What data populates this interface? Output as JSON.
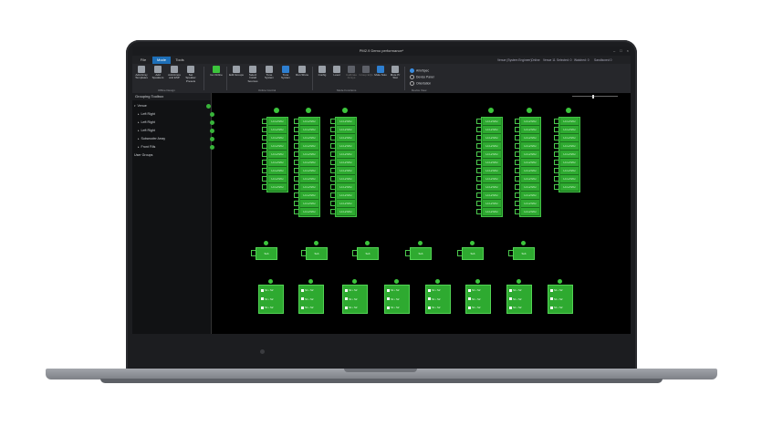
{
  "app": {
    "title": "PM2.9 Demo performance*",
    "window_controls": [
      "–",
      "□",
      "×"
    ],
    "tabs": [
      "File",
      "Mode",
      "Tools"
    ],
    "active_tab": "Mode",
    "status_items": [
      "Venue (System Engineer)",
      "Online",
      "Venue 11",
      "Selected: 0",
      "Watched: 0",
      "Sandboxed 0"
    ]
  },
  "ribbon": {
    "offline_buttons": [
      "Add Array Templates",
      "Add Speakers",
      "Add Amps and ESP",
      "Set Speaker Presets"
    ],
    "offline_group": "Offline Design",
    "go_online": "Go Online",
    "online_buttons": [
      "Edit Groups",
      "Select Install Sources",
      "Tune System",
      "Tune System",
      "Run Show"
    ],
    "online_group": "Online Control",
    "mode_buttons": [
      "Config",
      "Level",
      "Calibrate Arrays",
      "Group EQs",
      "Mute Solo",
      "Mute Pr Stat"
    ],
    "mode_group": "Mode Functions",
    "view_options": [
      "Aim/Spec",
      "Device Panel",
      "Orientation",
      "Device View"
    ]
  },
  "grouping": {
    "header": "Grouping Toolbox",
    "root": "Venue",
    "groups": [
      "Left Right",
      "Left Right",
      "Left Right",
      "Subwoofer Array",
      "Front Fills"
    ],
    "user_groups": "User Groups"
  },
  "canvas": {
    "arrays": [
      {
        "id": "a1",
        "rows": 9,
        "label": "L1 L2 M H"
      },
      {
        "id": "a2",
        "rows": 12,
        "label": "L1 L2 M H"
      },
      {
        "id": "a3",
        "rows": 12,
        "label": "L1 L2 M H"
      },
      {
        "id": "a4",
        "rows": 12,
        "label": "L1 L2 M H"
      },
      {
        "id": "a5",
        "rows": 12,
        "label": "L1 L2 M H"
      },
      {
        "id": "a6",
        "rows": 9,
        "label": "L1 L2 M H"
      }
    ],
    "subs_label": "Sub",
    "sub_count": 6,
    "fill_count": 8,
    "fill_line": "S1 • S2"
  },
  "colors": {
    "accent": "#3cc43c",
    "tab_blue": "#1d6fb8",
    "panel": "#111214"
  }
}
